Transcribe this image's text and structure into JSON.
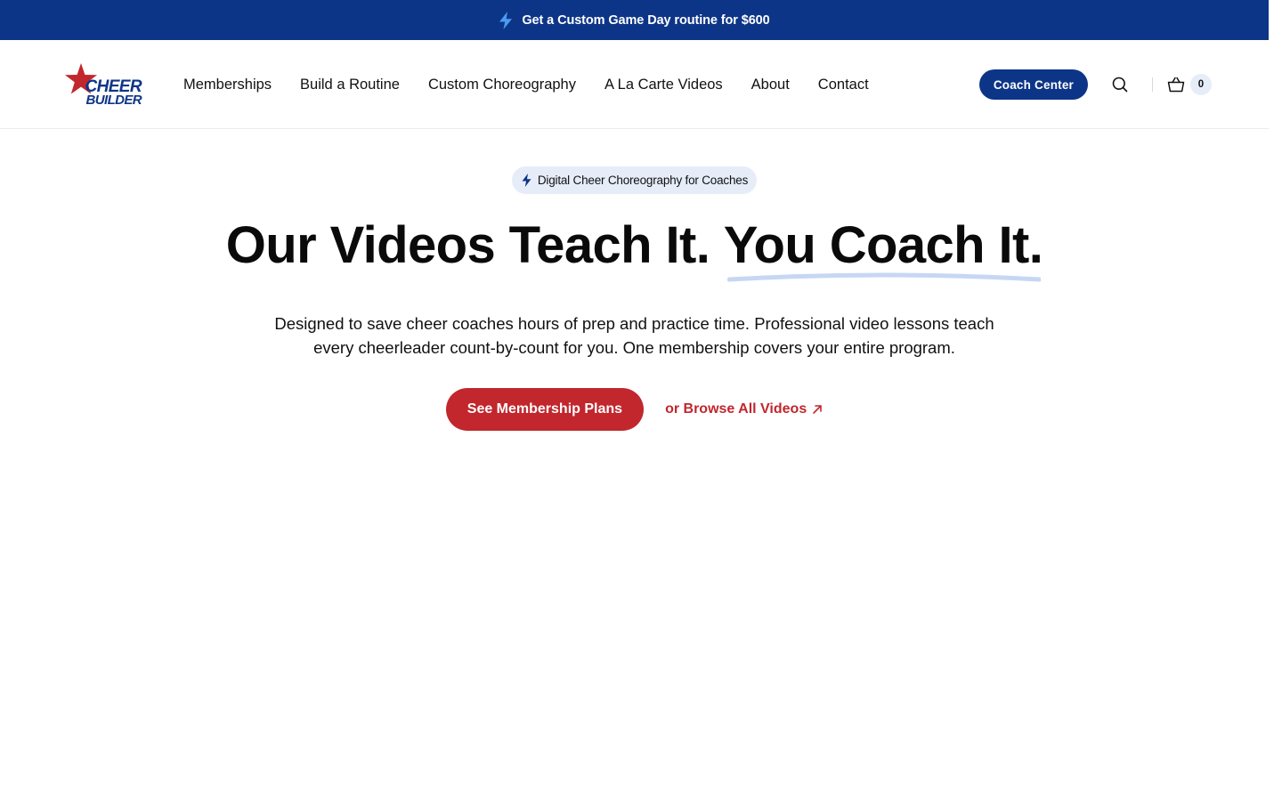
{
  "announcement": {
    "text": "Get a Custom Game Day routine for $600",
    "icon": "lightning-bolt-icon"
  },
  "header": {
    "logo": {
      "line1": "CHEER",
      "line2": "BUILDER",
      "icon": "star-icon"
    },
    "nav": [
      {
        "label": "Memberships"
      },
      {
        "label": "Build a Routine"
      },
      {
        "label": "Custom Choreography"
      },
      {
        "label": "A La Carte Videos"
      },
      {
        "label": "About"
      },
      {
        "label": "Contact"
      }
    ],
    "coach_center_label": "Coach Center",
    "search_icon": "search-icon",
    "cart_icon": "basket-icon",
    "cart_count": "0"
  },
  "hero": {
    "badge": "Digital Cheer Choreography for Coaches",
    "headline_part1": "Our Videos Teach It.",
    "headline_part2": "You Coach It.",
    "subtext": "Designed to save cheer coaches hours of prep and practice time. Professional video lessons teach every cheerleader count-by-count for you. One membership covers your entire program.",
    "primary_cta": "See Membership Plans",
    "secondary_cta": "or Browse All Videos",
    "secondary_icon": "arrow-up-right-icon"
  },
  "colors": {
    "brand_blue": "#0d3587",
    "brand_red": "#c1272d",
    "badge_bg": "#e6edf9",
    "accent_light_blue": "#4a9cf0",
    "underline": "#c7d7f3"
  }
}
